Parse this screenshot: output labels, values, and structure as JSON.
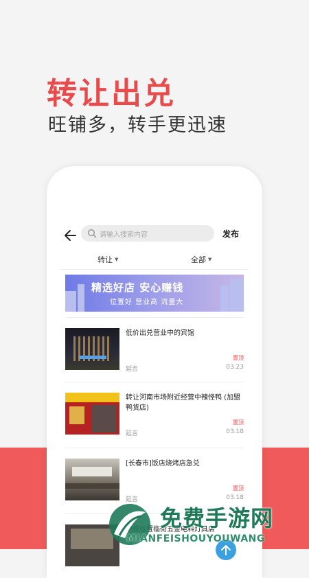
{
  "promo": {
    "title": "转让出兑",
    "subtitle": "旺铺多，转手更迅速"
  },
  "app": {
    "search": {
      "placeholder": "请输入搜索内容"
    },
    "publish_label": "发布",
    "filters": [
      {
        "label": "转让"
      },
      {
        "label": "全部"
      }
    ],
    "banner": {
      "title": "精选好店 安心赚钱",
      "subtitle": "位置好 营业高 流量大"
    },
    "listings": [
      {
        "title": "低价出兑营业中的宾馆",
        "tag": "置顶",
        "location": "延吉",
        "date": "03.23"
      },
      {
        "title": "转让河南市场附近经营中辣怪鸭 (加盟鸭货店)",
        "tag": "置顶",
        "location": "延吉",
        "date": "03.18"
      },
      {
        "title": "[长春市]饭店烧烤店急兑",
        "tag": "置顶",
        "location": "延吉",
        "date": "03.18"
      },
      {
        "title": "绝佳位置临街五金电料灯具店"
      }
    ]
  },
  "watermark": {
    "text": "免费手游网",
    "sub": "MIANFEISHOUYOUWANG"
  },
  "colors": {
    "accent": "#e84b4b",
    "band": "#f05a5a",
    "watermark": "#1f7a5a"
  }
}
